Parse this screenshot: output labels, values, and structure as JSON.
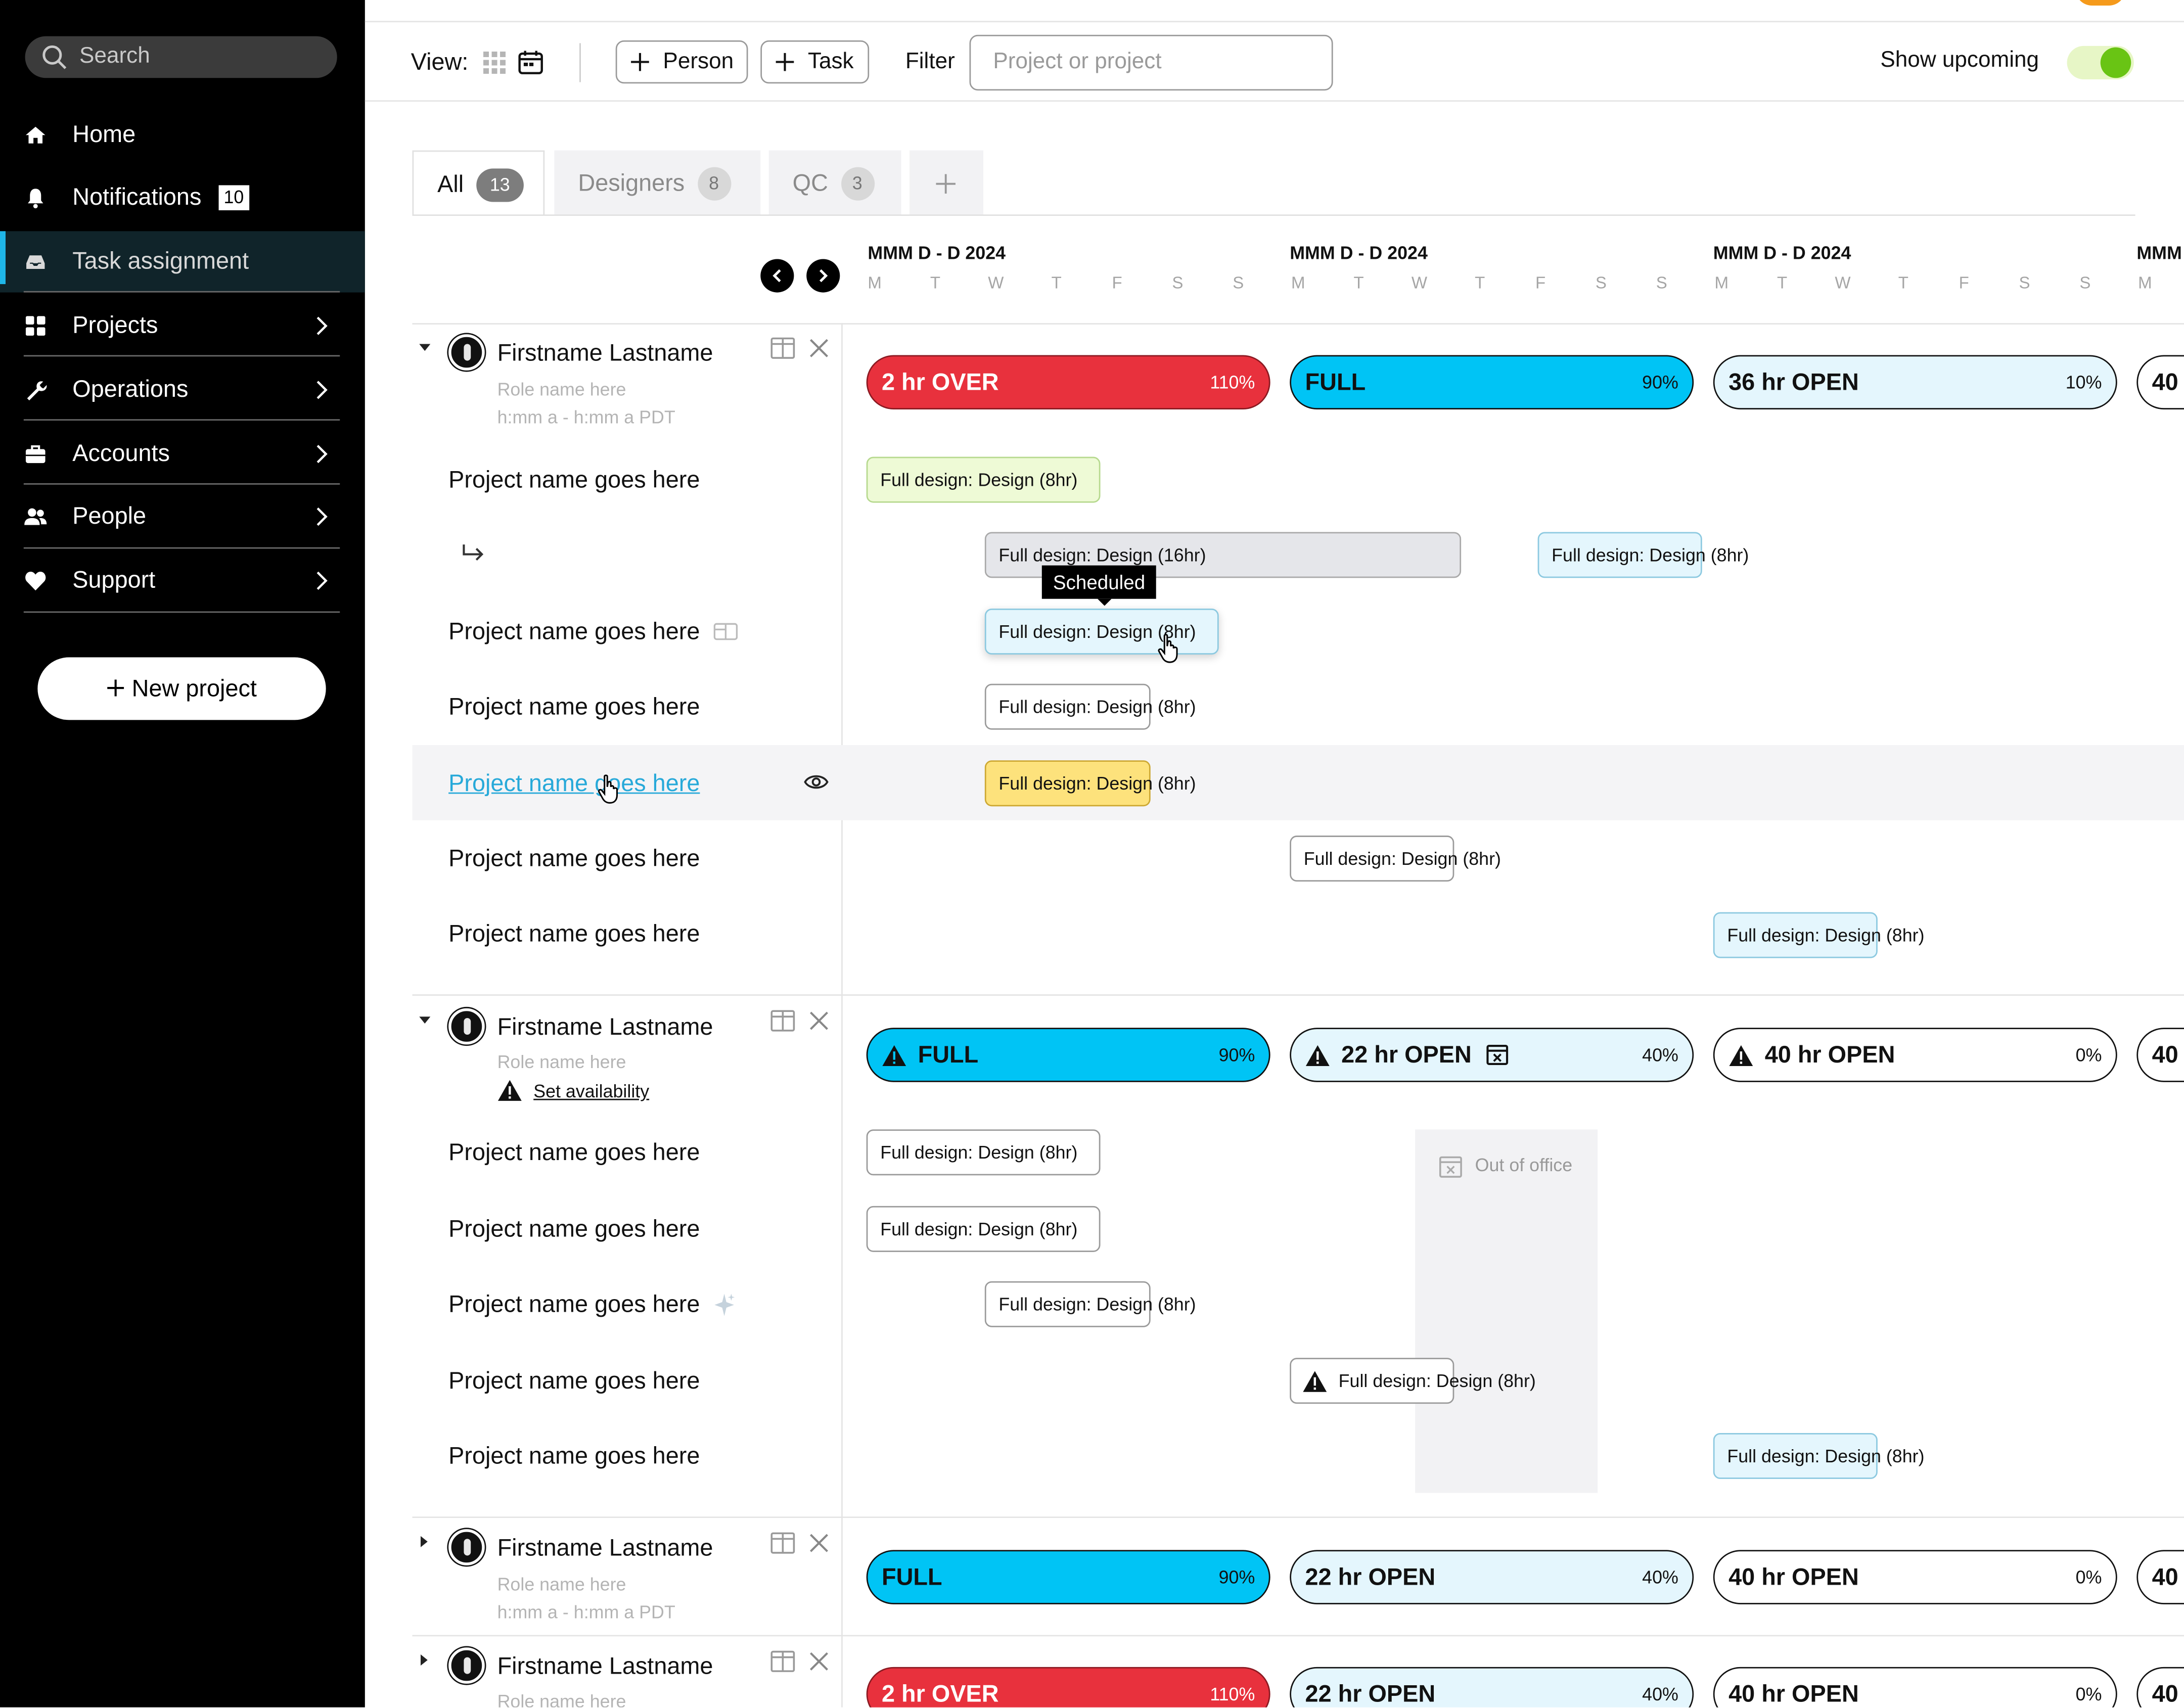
{
  "sidebar": {
    "search_placeholder": "Search",
    "items": [
      {
        "label": "Home",
        "icon": "home-icon"
      },
      {
        "label": "Notifications",
        "icon": "bell-icon",
        "badge": "10"
      },
      {
        "label": "Task assignment",
        "icon": "inbox-icon",
        "active": true
      },
      {
        "label": "Projects",
        "icon": "grid-icon"
      },
      {
        "label": "Operations",
        "icon": "wrench-icon"
      },
      {
        "label": "Accounts",
        "icon": "briefcase-icon"
      },
      {
        "label": "People",
        "icon": "people-icon"
      },
      {
        "label": "Support",
        "icon": "heart-icon"
      }
    ],
    "new_project": "New project"
  },
  "toolbar": {
    "view_label": "View:",
    "person_btn": "Person",
    "task_btn": "Task",
    "filter_label": "Filter",
    "filter_placeholder": "Project or project",
    "show_upcoming": "Show upcoming"
  },
  "tabs": [
    {
      "label": "All",
      "count": "13"
    },
    {
      "label": "Designers",
      "count": "8"
    },
    {
      "label": "QC",
      "count": "3"
    }
  ],
  "weeks": [
    "MMM D - D 2024",
    "MMM D - D 2024",
    "MMM D - D 2024",
    "MMM"
  ],
  "days": [
    "M",
    "T",
    "W",
    "T",
    "F",
    "S",
    "S"
  ],
  "persons": [
    {
      "name": "Firstname Lastname",
      "role": "Role name here",
      "hours": "h:mm a - h:mm a PDT",
      "capacity": [
        {
          "label": "2 hr OVER",
          "pct": "110%",
          "state": "over"
        },
        {
          "label": "FULL",
          "pct": "90%",
          "state": "full"
        },
        {
          "label": "36 hr OPEN",
          "pct": "10%",
          "state": "open"
        },
        {
          "label": "40"
        }
      ],
      "projects": [
        "Project name goes here",
        "",
        "Project name goes here",
        "Project name goes here",
        "Project name goes here",
        "Project name goes here",
        "Project name goes here"
      ]
    },
    {
      "name": "Firstname Lastname",
      "role": "Role name here",
      "set_availability": "Set availability",
      "capacity": [
        {
          "label": "FULL",
          "pct": "90%",
          "state": "full",
          "warn": true
        },
        {
          "label": "22 hr OPEN",
          "pct": "40%",
          "state": "open",
          "warn": true
        },
        {
          "label": "40 hr OPEN",
          "pct": "0%",
          "state": "zero",
          "warn": true
        },
        {
          "label": "40"
        }
      ],
      "projects": [
        "Project name goes here",
        "Project name goes here",
        "Project name goes here",
        "Project name goes here",
        "Project name goes here"
      ]
    },
    {
      "name": "Firstname Lastname",
      "role": "Role name here",
      "hours": "h:mm a - h:mm a PDT",
      "capacity": [
        {
          "label": "FULL",
          "pct": "90%",
          "state": "full"
        },
        {
          "label": "22 hr OPEN",
          "pct": "40%",
          "state": "open"
        },
        {
          "label": "40 hr OPEN",
          "pct": "0%",
          "state": "zero"
        },
        {
          "label": "40"
        }
      ]
    },
    {
      "name": "Firstname Lastname",
      "role": "Role name here",
      "capacity": [
        {
          "label": "2 hr OVER",
          "pct": "110%",
          "state": "over"
        },
        {
          "label": "22 hr OPEN",
          "pct": "40%",
          "state": "open"
        },
        {
          "label": "40 hr OPEN",
          "pct": "0%",
          "state": "zero"
        },
        {
          "label": "40"
        }
      ]
    }
  ],
  "tasks": {
    "t8": "Full design: Design (8hr)",
    "t16": "Full design: Design (16hr)"
  },
  "tooltip": "Scheduled",
  "out_of_office": "Out of office"
}
